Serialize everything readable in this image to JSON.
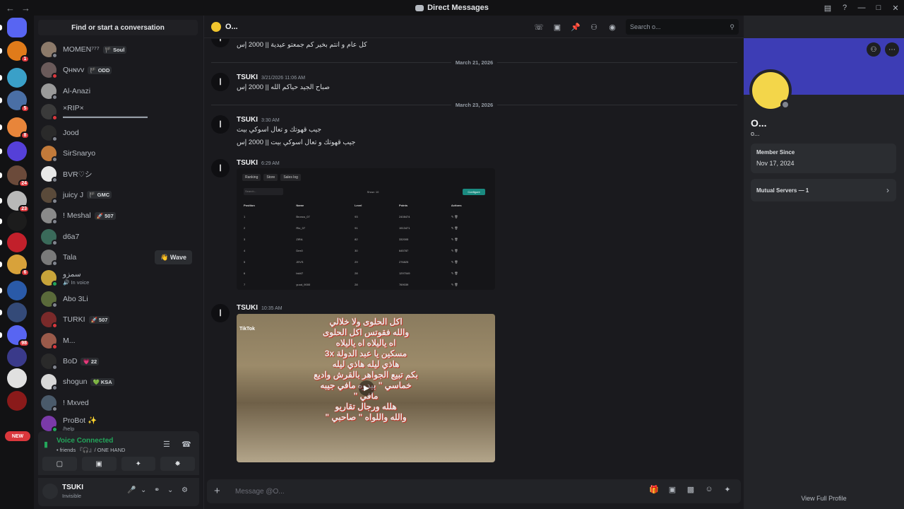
{
  "window": {
    "title": "Direct Messages"
  },
  "sidebar": {
    "find_label": "Find or start a conversation",
    "new_label": "NEW",
    "servers": [
      {
        "color": "#5865f2",
        "badge": ""
      },
      {
        "color": "#e07b1a",
        "badge": "1"
      },
      {
        "color": "#3aa0c8",
        "badge": ""
      },
      {
        "color": "#4a6fa5",
        "badge": "5"
      },
      {
        "color": "#e8853a",
        "badge": "8"
      },
      {
        "color": "#5540d8",
        "badge": ""
      },
      {
        "color": "#6b4a3a",
        "badge": "24"
      },
      {
        "color": "#b8b8b8",
        "badge": "23"
      },
      {
        "color": "#1c1c1c",
        "badge": ""
      },
      {
        "color": "#c2202b",
        "badge": ""
      },
      {
        "color": "#d8a23a",
        "badge": "6"
      },
      {
        "color": "#2a5aa8",
        "badge": ""
      },
      {
        "color": "#344a78",
        "badge": ""
      },
      {
        "color": "#5865f2",
        "badge": "98"
      },
      {
        "color": "#3a3a8a",
        "badge": ""
      },
      {
        "color": "#e0e0e0",
        "badge": ""
      },
      {
        "color": "#8a1a1a",
        "badge": ""
      }
    ]
  },
  "dms": [
    {
      "name": "MOMEN⁷⁷⁷",
      "tag": "🏴 Soul",
      "sub": "",
      "color": "#8c7a6a",
      "status": "#80848e",
      "wave": ""
    },
    {
      "name": "Qʜɴᴠᴠ",
      "tag": "🏴 ODD",
      "sub": "",
      "color": "#6a5a5a",
      "status": "#da373c",
      "wave": ""
    },
    {
      "name": "Al-Anazi",
      "tag": "",
      "sub": "",
      "color": "#9a9a9a",
      "status": "#80848e",
      "wave": ""
    },
    {
      "name": "×RIP×",
      "tag": "",
      "sub": "▬▬▬▬▬▬▬▬▬▬▬▬▬▬▬▬",
      "color": "#3a3a3a",
      "status": "#da373c",
      "wave": ""
    },
    {
      "name": "Jood",
      "tag": "",
      "sub": "",
      "color": "#2a2a2a",
      "status": "#80848e",
      "wave": ""
    },
    {
      "name": "SirSnaryo",
      "tag": "",
      "sub": "",
      "color": "#c27a3a",
      "status": "#80848e",
      "wave": ""
    },
    {
      "name": "BVR♡シ",
      "tag": "",
      "sub": "",
      "color": "#e8e8e8",
      "status": "#80848e",
      "wave": ""
    },
    {
      "name": "juicy J",
      "tag": "🏴 GMC",
      "sub": "",
      "color": "#5a4a3a",
      "status": "#80848e",
      "wave": ""
    },
    {
      "name": "! Meshal",
      "tag": "🚀 507",
      "sub": "",
      "color": "#8a8a8a",
      "status": "#80848e",
      "wave": ""
    },
    {
      "name": "d6a7",
      "tag": "",
      "sub": "",
      "color": "#3a6a5a",
      "status": "#80848e",
      "wave": ""
    },
    {
      "name": "Tala",
      "tag": "",
      "sub": "",
      "color": "#7a7a7a",
      "status": "#80848e",
      "wave": "👋 Wave"
    },
    {
      "name": "سمزو",
      "tag": "",
      "sub": "🔊 In voice",
      "color": "#c8a43a",
      "status": "#23a55a",
      "wave": ""
    },
    {
      "name": "Abo 3Li",
      "tag": "",
      "sub": "",
      "color": "#5a6a3a",
      "status": "#80848e",
      "wave": ""
    },
    {
      "name": "TURKI",
      "tag": "🚀 507",
      "sub": "",
      "color": "#7a2a2a",
      "status": "#da373c",
      "wave": ""
    },
    {
      "name": "M...",
      "tag": "",
      "sub": "",
      "color": "#9a5a4a",
      "status": "#da373c",
      "wave": ""
    },
    {
      "name": "BoD",
      "tag": "💗 22",
      "sub": "",
      "color": "#2a2a2a",
      "status": "#80848e",
      "wave": ""
    },
    {
      "name": "shogun",
      "tag": "💚 KSA",
      "sub": "",
      "color": "#d8d8d8",
      "status": "#80848e",
      "wave": ""
    },
    {
      "name": "! Mxved",
      "tag": "",
      "sub": "",
      "color": "#4a5a6a",
      "status": "#80848e",
      "wave": ""
    },
    {
      "name": "ProBot ✨",
      "tag": "",
      "sub": "/help",
      "color": "#7a3aa8",
      "status": "#23a55a",
      "wave": ""
    }
  ],
  "voice": {
    "title": "Voice Connected",
    "sub": "• friends 『🎧』/ ONE HAND"
  },
  "user": {
    "name": "TSUKI",
    "status": "Invisible"
  },
  "chat": {
    "header_name": "O...",
    "search_placeholder": "Search o...",
    "top_text": "كل عام و انتم بخير كم جمعتو عيدية || 2000 إس",
    "dates": [
      "March 21, 2026",
      "March 23, 2026"
    ],
    "messages": [
      {
        "author": "TSUKI",
        "time": "3/21/2026 11:06 AM",
        "lines": [
          "صباح الجيد حياكم الله || 2000 إس"
        ]
      },
      {
        "author": "TSUKI",
        "time": "3:30 AM",
        "lines": [
          "جيب قهوتك و تعال اسوكي بيت",
          "جيب قهوتك و تعال اسوكي بيت || 2000 إس"
        ]
      },
      {
        "author": "TSUKI",
        "time": "6:29 AM",
        "lines": []
      },
      {
        "author": "TSUKI",
        "time": "10:35 AM",
        "lines": []
      }
    ],
    "screenshot": {
      "tabs": [
        "Ranking",
        "Store",
        "Sales log"
      ],
      "search": "Search...",
      "show": "Show: 10",
      "button": "Configure",
      "columns": [
        "Position",
        "Name",
        "Level",
        "Points",
        "Actions"
      ],
      "rows": [
        [
          "1",
          "Bronco_07",
          "93",
          "2408474",
          "✎ 🗑"
        ],
        [
          "2",
          "Rio_07",
          "91",
          "1913471",
          "✎ 🗑"
        ],
        [
          "3",
          "ZIRA",
          "82",
          "332005",
          "✎ 🗑"
        ],
        [
          "4",
          "Dex0",
          "30",
          "645787",
          "✎ 🗑"
        ],
        [
          "5",
          "JEVS",
          "29",
          "276825",
          "✎ 🗑"
        ],
        [
          "6",
          "bid47",
          "28",
          "1297049",
          "✎ 🗑"
        ],
        [
          "7",
          "yuud_9000",
          "28",
          "769039",
          "✎ 🗑"
        ]
      ]
    },
    "video": {
      "logo": "TikTok",
      "lines": [
        "اكل الحلوى ولا خلالي",
        "والله فقوتس اكل الحلوى",
        "اه ياليلاه اه ياليلاه",
        "مسكين يا عبد الدولة 3x",
        "هاذي ليله هاذي ليله",
        "بكم تبيع الجواهر بالقرش واديع",
        "خماسي \" بيدوه مافي جيبه",
        "مافي \"",
        "هلله ورجال تقاريو",
        "والله واللواه \" صاحبي \""
      ]
    },
    "composer_placeholder": "Message @O..."
  },
  "profile": {
    "name": "O...",
    "username": "o...",
    "member_since_label": "Member Since",
    "member_since": "Nov 17, 2024",
    "mutual_servers": "Mutual Servers — 1",
    "view_full": "View Full Profile",
    "banner_color": "#3d3db5"
  }
}
